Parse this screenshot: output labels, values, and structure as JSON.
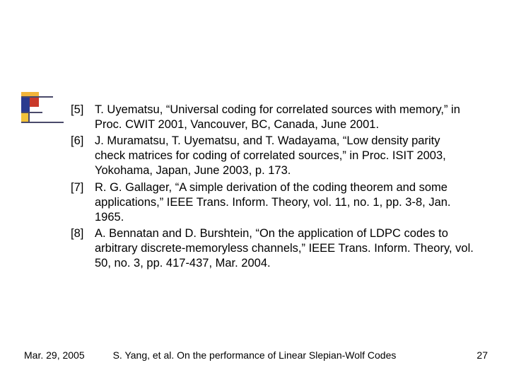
{
  "references": [
    {
      "num": "[5]",
      "text": "T. Uyematsu, “Universal coding for correlated sources with memory,” in Proc. CWIT 2001, Vancouver, BC, Canada, June 2001."
    },
    {
      "num": "[6]",
      "text": "J. Muramatsu, T. Uyematsu, and T. Wadayama, “Low density parity check matrices for coding of correlated sources,” in Proc. ISIT 2003, Yokohama, Japan, June 2003, p. 173."
    },
    {
      "num": "[7]",
      "text": "R. G. Gallager, “A simple derivation of the coding theorem and some applications,” IEEE Trans. Inform. Theory, vol. 11, no. 1, pp. 3-8, Jan. 1965."
    },
    {
      "num": "[8]",
      "text": "A. Bennatan and D. Burshtein, “On the application of LDPC codes to arbitrary discrete-memoryless channels,” IEEE Trans. Inform. Theory, vol. 50, no. 3, pp. 417-437, Mar. 2004."
    }
  ],
  "footer": {
    "date": "Mar. 29, 2005",
    "title": "S. Yang, et al. On the performance of Linear Slepian-Wolf Codes",
    "page": "27"
  }
}
